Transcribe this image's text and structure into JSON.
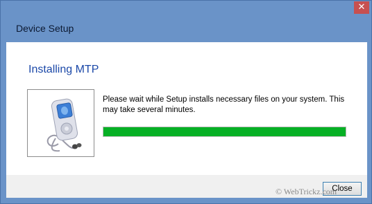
{
  "window": {
    "title": "Device Setup",
    "close_glyph": "✕"
  },
  "content": {
    "heading": "Installing MTP",
    "message": "Please wait while Setup installs necessary files on your system. This may take several minutes.",
    "device_icon": "media-player-icon",
    "progress_fraction": 1.0
  },
  "footer": {
    "close_label": "Close"
  },
  "watermark": {
    "text": "© WebTrickz.com"
  },
  "colors": {
    "frame": "#6a93c8",
    "heading": "#1b48a8",
    "progress": "#06b025",
    "close_button_bg": "#c75050"
  }
}
